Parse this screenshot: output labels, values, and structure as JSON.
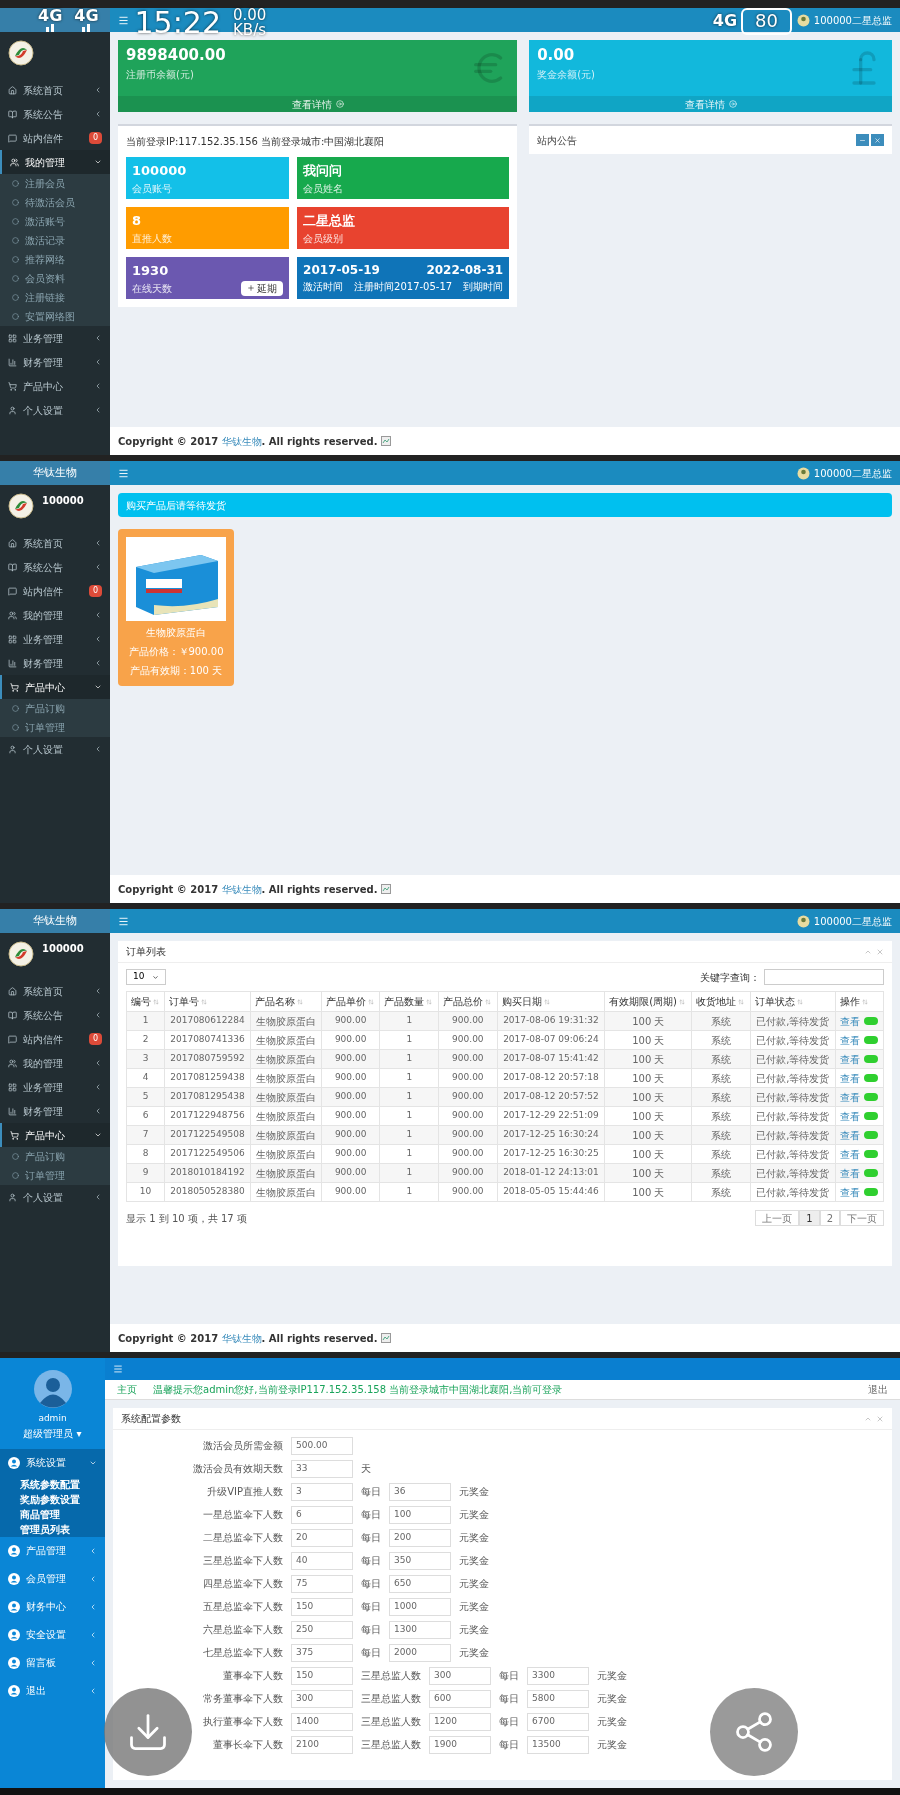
{
  "status_bar": {
    "left": [
      "4G",
      "4G"
    ],
    "time": "15:22",
    "speed": "0.00",
    "speed_unit": "KB/s",
    "right_signal": "4G",
    "battery": "80"
  },
  "panels": [
    {
      "kind": "dashboard",
      "header": {
        "user": "100000二星总监"
      },
      "sidebar": {
        "items": [
          {
            "label": "系统首页",
            "expanded": false
          },
          {
            "label": "系统公告",
            "expanded": false
          },
          {
            "label": "站内信件",
            "badge": "0",
            "expanded": false
          },
          {
            "label": "我的管理",
            "expanded": true,
            "children": [
              "注册会员",
              "待激活会员",
              "激活账号",
              "激活记录",
              "推荐网络",
              "会员资料",
              "注册链接",
              "安置网络图"
            ]
          },
          {
            "label": "业务管理",
            "expanded": false
          },
          {
            "label": "财务管理",
            "expanded": false
          },
          {
            "label": "产品中心",
            "expanded": false
          },
          {
            "label": "个人设置",
            "expanded": false
          }
        ]
      },
      "balances": [
        {
          "value": "9898400.00",
          "label": "注册币余额(元)",
          "link": "查看详情",
          "color": "#1fa35a"
        },
        {
          "value": "0.00",
          "label": "奖金余额(元)",
          "link": "查看详情",
          "color": "#12b8dc"
        }
      ],
      "login_info": "当前登录IP:117.152.35.156 当前登录城市:中国湖北襄阳",
      "stats": [
        {
          "kind": "stat",
          "value": "100000",
          "label": "会员账号",
          "color": "#13c0e8"
        },
        {
          "kind": "stat",
          "value": "我问问",
          "label": "会员姓名",
          "color": "#17a94d"
        },
        {
          "kind": "stat",
          "value": "8",
          "label": "直推人数",
          "color": "#ff9c00"
        },
        {
          "kind": "stat",
          "value": "二星总监",
          "label": "会员级别",
          "color": "#e8432f"
        },
        {
          "kind": "button",
          "value": "1930",
          "label": "在线天数",
          "button": "延期",
          "color": "#6b58b0"
        },
        {
          "kind": "dates",
          "value": "2017-05-19",
          "value2": "2022-08-31",
          "label": "激活时间",
          "label2": "注册时间2017-05-17",
          "label3": "到期时间",
          "color": "#0f74b8"
        }
      ],
      "notice_title": "站内公告",
      "footer": {
        "before": "Copyright © 2017 ",
        "link": "华钛生物",
        "after": ". All rights reserved."
      }
    },
    {
      "kind": "products",
      "header": {
        "brand": "华钛生物",
        "user": "100000二星总监"
      },
      "sidebar": {
        "user": "100000",
        "items": [
          {
            "label": "系统首页",
            "expanded": false
          },
          {
            "label": "系统公告",
            "expanded": false
          },
          {
            "label": "站内信件",
            "badge": "0",
            "expanded": false
          },
          {
            "label": "我的管理",
            "expanded": false
          },
          {
            "label": "业务管理",
            "expanded": false
          },
          {
            "label": "财务管理",
            "expanded": false
          },
          {
            "label": "产品中心",
            "expanded": true,
            "children": [
              "产品订购",
              "订单管理"
            ]
          },
          {
            "label": "个人设置",
            "expanded": false
          }
        ]
      },
      "banner": "购买产品后请等待发货",
      "products": [
        {
          "name": "生物胶原蛋白",
          "price": "产品价格：￥900.00",
          "period": "产品有效期：100 天"
        }
      ],
      "footer": {
        "before": "Copyright © 2017 ",
        "link": "华钛生物",
        "after": ". All rights reserved."
      }
    },
    {
      "kind": "orders",
      "header": {
        "brand": "华钛生物",
        "user": "100000二星总监"
      },
      "sidebar": {
        "user": "100000",
        "items": [
          {
            "label": "系统首页",
            "expanded": false
          },
          {
            "label": "系统公告",
            "expanded": false
          },
          {
            "label": "站内信件",
            "badge": "0",
            "expanded": false
          },
          {
            "label": "我的管理",
            "expanded": false
          },
          {
            "label": "业务管理",
            "expanded": false
          },
          {
            "label": "财务管理",
            "expanded": false
          },
          {
            "label": "产品中心",
            "expanded": true,
            "children": [
              "产品订购",
              "订单管理"
            ]
          },
          {
            "label": "个人设置",
            "expanded": false
          }
        ]
      },
      "title": "订单列表",
      "page_size": "10",
      "search_label": "关键字查询：",
      "columns": [
        "编号",
        "订单号",
        "产品名称",
        "产品单价",
        "产品数量",
        "产品总价",
        "购买日期",
        "有效期限(周期)",
        "收货地址",
        "订单状态",
        "操作"
      ],
      "rows": [
        {
          "cells": [
            "1",
            "2017080612284",
            "生物胶原蛋白",
            "900.00",
            "1",
            "900.00",
            "2017-08-06 19:31:32",
            "100 天",
            "系统",
            "已付款,等待发货"
          ],
          "action": "查看",
          "on": true
        },
        {
          "cells": [
            "2",
            "2017080741336",
            "生物胶原蛋白",
            "900.00",
            "1",
            "900.00",
            "2017-08-07 09:06:24",
            "100 天",
            "系统",
            "已付款,等待发货"
          ],
          "action": "查看",
          "on": true
        },
        {
          "cells": [
            "3",
            "2017080759592",
            "生物胶原蛋白",
            "900.00",
            "1",
            "900.00",
            "2017-08-07 15:41:42",
            "100 天",
            "系统",
            "已付款,等待发货"
          ],
          "action": "查看",
          "on": true
        },
        {
          "cells": [
            "4",
            "2017081259438",
            "生物胶原蛋白",
            "900.00",
            "1",
            "900.00",
            "2017-08-12 20:57:18",
            "100 天",
            "系统",
            "已付款,等待发货"
          ],
          "action": "查看",
          "on": true
        },
        {
          "cells": [
            "5",
            "2017081295438",
            "生物胶原蛋白",
            "900.00",
            "1",
            "900.00",
            "2017-08-12 20:57:52",
            "100 天",
            "系统",
            "已付款,等待发货"
          ],
          "action": "查看",
          "on": true
        },
        {
          "cells": [
            "6",
            "2017122948756",
            "生物胶原蛋白",
            "900.00",
            "1",
            "900.00",
            "2017-12-29 22:51:09",
            "100 天",
            "系统",
            "已付款,等待发货"
          ],
          "action": "查看",
          "on": true
        },
        {
          "cells": [
            "7",
            "2017122549508",
            "生物胶原蛋白",
            "900.00",
            "1",
            "900.00",
            "2017-12-25 16:30:24",
            "100 天",
            "系统",
            "已付款,等待发货"
          ],
          "action": "查看",
          "on": true
        },
        {
          "cells": [
            "8",
            "2017122549506",
            "生物胶原蛋白",
            "900.00",
            "1",
            "900.00",
            "2017-12-25 16:30:25",
            "100 天",
            "系统",
            "已付款,等待发货"
          ],
          "action": "查看",
          "on": true
        },
        {
          "cells": [
            "9",
            "2018010184192",
            "生物胶原蛋白",
            "900.00",
            "1",
            "900.00",
            "2018-01-12 24:13:01",
            "100 天",
            "系统",
            "已付款,等待发货"
          ],
          "action": "查看",
          "on": true
        },
        {
          "cells": [
            "10",
            "2018050528380",
            "生物胶原蛋白",
            "900.00",
            "1",
            "900.00",
            "2018-05-05 15:44:46",
            "100 天",
            "系统",
            "已付款,等待发货"
          ],
          "action": "查看",
          "on": true
        }
      ],
      "summary": "显示 1 到 10 项，共 17 项",
      "pages": [
        {
          "label": "上一页",
          "selected": false
        },
        {
          "label": "1",
          "selected": true
        },
        {
          "label": "2",
          "selected": false
        },
        {
          "label": "下一页",
          "selected": false
        }
      ],
      "footer": {
        "before": "Copyright © 2017 ",
        "link": "华钛生物",
        "after": ". All rights reserved."
      }
    },
    {
      "kind": "settings",
      "sidebar": {
        "user": "admin",
        "role": "超级管理员 ▾",
        "items": [
          {
            "label": "系统设置",
            "expanded": true,
            "children": [
              "系统参数配置",
              "奖励参数设置",
              "商品管理",
              "管理员列表"
            ]
          },
          {
            "label": "产品管理",
            "expanded": false
          },
          {
            "label": "会员管理",
            "expanded": false
          },
          {
            "label": "财务中心",
            "expanded": false
          },
          {
            "label": "安全设置",
            "expanded": false
          },
          {
            "label": "留言板",
            "expanded": false
          },
          {
            "label": "退出",
            "expanded": false
          }
        ]
      },
      "home_tab": "主页",
      "notice": "温馨提示您admin您好,当前登录IP117.152.35.158 当前登录城市中国湖北襄阳,当前可登录",
      "logout": "退出",
      "title": "系统配置参数",
      "rows": [
        {
          "kind": "single",
          "label": "激活会员所需金额",
          "value": "500.00"
        },
        {
          "kind": "single",
          "label": "激活会员有效期天数",
          "value": "33",
          "unit": "天"
        },
        {
          "kind": "daily",
          "label": "升级VIP直推人数",
          "value": "3",
          "daily": "每日",
          "amount": "36",
          "unit": "元奖金"
        },
        {
          "kind": "daily",
          "label": "一星总监伞下人数",
          "value": "6",
          "daily": "每日",
          "amount": "100",
          "unit": "元奖金"
        },
        {
          "kind": "daily",
          "label": "二星总监伞下人数",
          "value": "20",
          "daily": "每日",
          "amount": "200",
          "unit": "元奖金"
        },
        {
          "kind": "daily",
          "label": "三星总监伞下人数",
          "value": "40",
          "daily": "每日",
          "amount": "350",
          "unit": "元奖金"
        },
        {
          "kind": "daily",
          "label": "四星总监伞下人数",
          "value": "75",
          "daily": "每日",
          "amount": "650",
          "unit": "元奖金"
        },
        {
          "kind": "daily",
          "label": "五星总监伞下人数",
          "value": "150",
          "daily": "每日",
          "amount": "1000",
          "unit": "元奖金"
        },
        {
          "kind": "daily",
          "label": "六星总监伞下人数",
          "value": "250",
          "daily": "每日",
          "amount": "1300",
          "unit": "元奖金"
        },
        {
          "kind": "daily",
          "label": "七星总监伞下人数",
          "value": "375",
          "daily": "每日",
          "amount": "2000",
          "unit": "元奖金"
        },
        {
          "kind": "team",
          "label": "董事伞下人数",
          "value": "150",
          "label2": "三星总监人数",
          "value2": "300",
          "daily": "每日",
          "amount": "3300",
          "unit": "元奖金"
        },
        {
          "kind": "team",
          "label": "常务董事伞下人数",
          "value": "300",
          "label2": "三星总监人数",
          "value2": "600",
          "daily": "每日",
          "amount": "5800",
          "unit": "元奖金"
        },
        {
          "kind": "team",
          "label": "执行董事伞下人数",
          "value": "1400",
          "label2": "三星总监人数",
          "value2": "1200",
          "daily": "每日",
          "amount": "6700",
          "unit": "元奖金"
        },
        {
          "kind": "team",
          "label": "董事长伞下人数",
          "value": "2100",
          "label2": "三星总监人数",
          "value2": "1900",
          "daily": "每日",
          "amount": "13500",
          "unit": "元奖金"
        }
      ]
    }
  ]
}
